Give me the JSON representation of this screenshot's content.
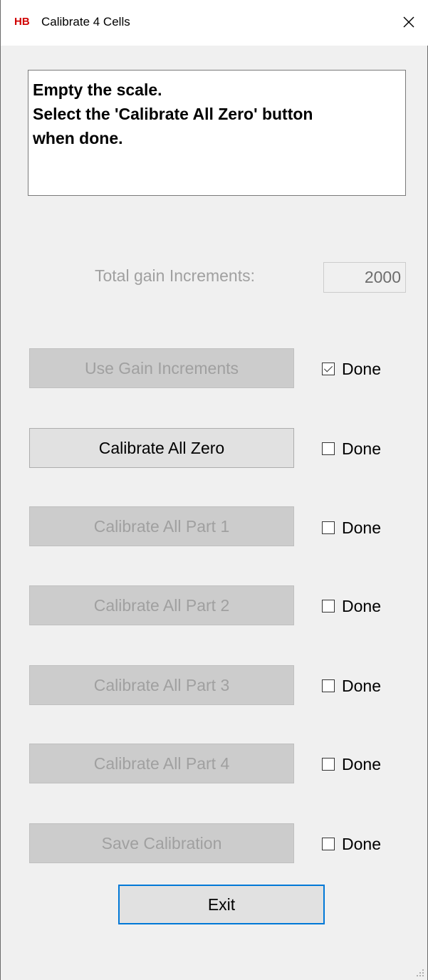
{
  "window": {
    "logo": "HB",
    "title": "Calibrate 4 Cells",
    "close_icon": "close-icon"
  },
  "instructions": "Empty the scale.\nSelect the 'Calibrate All Zero' button\nwhen done.",
  "gain": {
    "label": "Total gain Increments:",
    "value": "2000"
  },
  "steps": [
    {
      "label": "Use Gain Increments",
      "enabled": false,
      "done_label": "Done",
      "done": true
    },
    {
      "label": "Calibrate All Zero",
      "enabled": true,
      "done_label": "Done",
      "done": false
    },
    {
      "label": "Calibrate All Part 1",
      "enabled": false,
      "done_label": "Done",
      "done": false
    },
    {
      "label": "Calibrate All Part 2",
      "enabled": false,
      "done_label": "Done",
      "done": false
    },
    {
      "label": "Calibrate All Part 3",
      "enabled": false,
      "done_label": "Done",
      "done": false
    },
    {
      "label": "Calibrate All Part 4",
      "enabled": false,
      "done_label": "Done",
      "done": false
    },
    {
      "label": "Save Calibration",
      "enabled": false,
      "done_label": "Done",
      "done": false
    }
  ],
  "exit_label": "Exit",
  "colors": {
    "logo": "#d00000",
    "focus_border": "#0078d7",
    "disabled_text": "#a0a0a0"
  }
}
